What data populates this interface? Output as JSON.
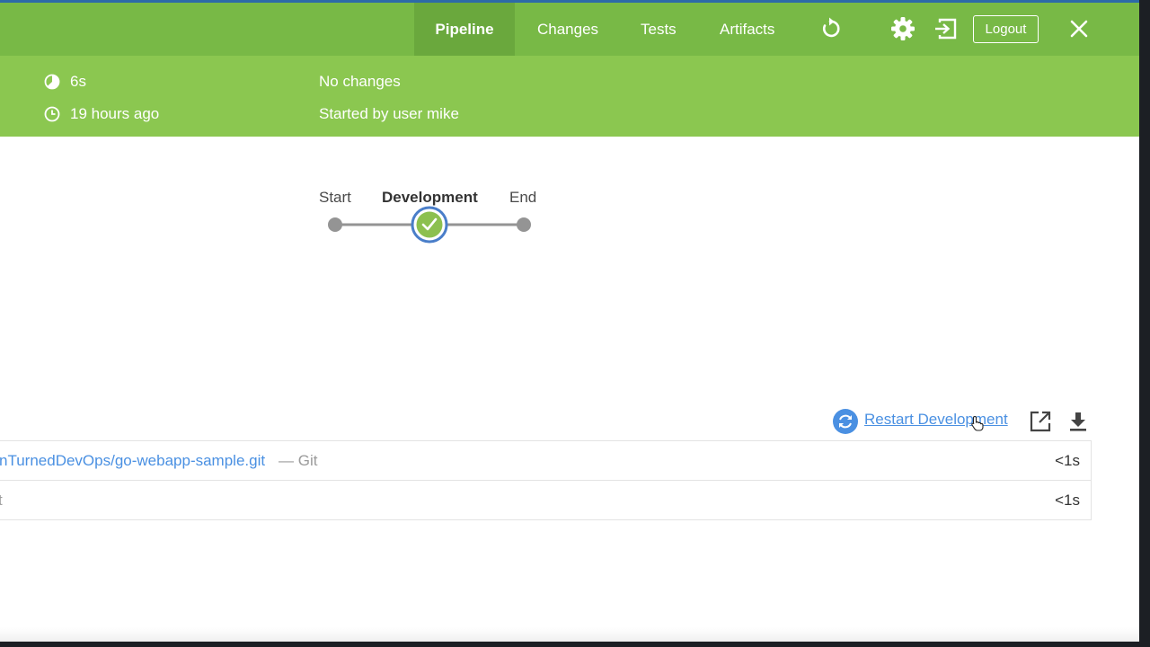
{
  "nav": {
    "tabs": [
      {
        "label": "Pipeline",
        "active": true
      },
      {
        "label": "Changes",
        "active": false
      },
      {
        "label": "Tests",
        "active": false
      },
      {
        "label": "Artifacts",
        "active": false
      }
    ],
    "logout_label": "Logout",
    "icons": [
      "replay-icon",
      "gear-icon",
      "exit-icon",
      "close-icon"
    ]
  },
  "run_info": {
    "duration": "6s",
    "started_ago": "19 hours ago",
    "changes": "No changes",
    "started_by": "Started by user mike"
  },
  "pipeline": {
    "stages": [
      {
        "label": "Start",
        "status": "none"
      },
      {
        "label": "Development",
        "status": "success",
        "selected": true
      },
      {
        "label": "End",
        "status": "none"
      }
    ]
  },
  "stage_actions": {
    "restart_label": "Restart Development",
    "icons": [
      "restart-icon",
      "open-external-icon",
      "download-icon"
    ]
  },
  "steps": [
    {
      "text": "nTurnedDevOps/go-webapp-sample.git",
      "suffix": "— Git",
      "duration": "<1s"
    },
    {
      "text": "t",
      "suffix": "",
      "duration": "<1s"
    }
  ],
  "colors": {
    "header": "#78b946",
    "info_bar": "#8bc750",
    "success": "#8cc04f",
    "selected_ring": "#4a7ec9",
    "link": "#4a90e2"
  }
}
